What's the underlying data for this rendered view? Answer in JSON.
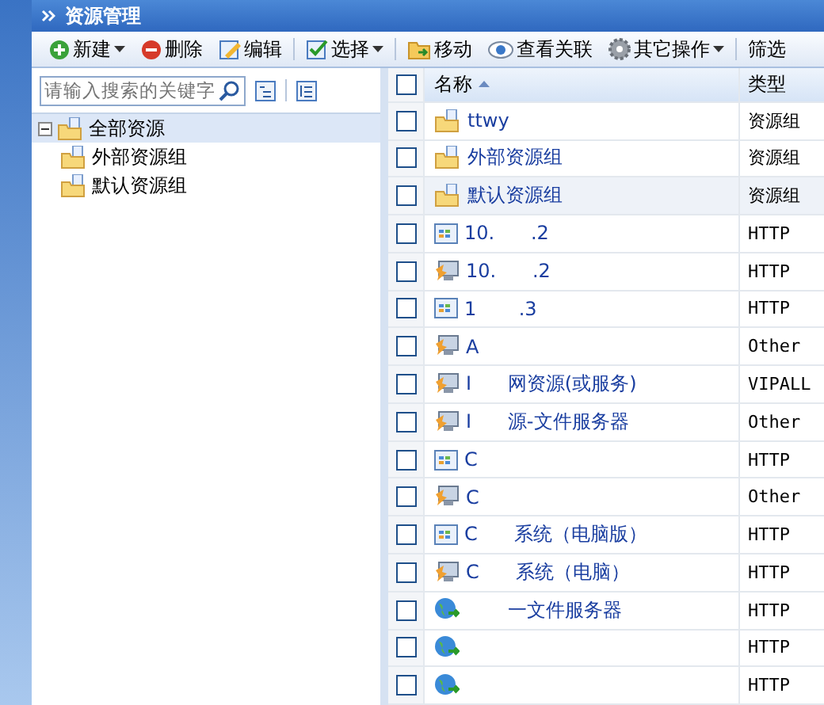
{
  "window": {
    "title": "资源管理"
  },
  "toolbar": [
    {
      "label": "新建",
      "kind": "add",
      "dropdown": true
    },
    {
      "label": "删除",
      "kind": "delete",
      "dropdown": false
    },
    {
      "label": "编辑",
      "kind": "edit",
      "dropdown": false
    },
    {
      "label": "选择",
      "kind": "check",
      "dropdown": true
    },
    {
      "label": "移动",
      "kind": "move",
      "dropdown": false
    },
    {
      "label": "查看关联",
      "kind": "eye",
      "dropdown": false
    },
    {
      "label": "其它操作",
      "kind": "gear",
      "dropdown": true
    },
    {
      "label": "筛选",
      "kind": "plain",
      "dropdown": false
    }
  ],
  "search": {
    "placeholder": "请输入搜索的关键字"
  },
  "tree": [
    {
      "label": "全部资源",
      "expanded": true,
      "selected": true,
      "children": [
        {
          "label": "外部资源组",
          "selected": false
        },
        {
          "label": "默认资源组",
          "selected": false
        }
      ]
    }
  ],
  "table": {
    "columns": [
      "名称",
      "类型"
    ],
    "all_checked": false,
    "rows": [
      {
        "kind": "folder",
        "name": "ttwy",
        "type": "资源组",
        "checked": false,
        "selected": false
      },
      {
        "kind": "folder",
        "name": "外部资源组",
        "type": "资源组",
        "checked": false,
        "selected": false
      },
      {
        "kind": "folder",
        "name": "默认资源组",
        "type": "资源组",
        "checked": false,
        "selected": true
      },
      {
        "kind": "app",
        "name": "10.      .2",
        "type": "HTTP",
        "checked": false,
        "selected": false
      },
      {
        "kind": "monitor",
        "name": "10.      .2",
        "type": "HTTP",
        "checked": false,
        "selected": false
      },
      {
        "kind": "app",
        "name": "1       .3",
        "type": "HTTP",
        "checked": false,
        "selected": false
      },
      {
        "kind": "monitor",
        "name": "A",
        "type": "Other",
        "checked": false,
        "selected": false
      },
      {
        "kind": "monitor",
        "name": "I      网资源(或服务)",
        "type": "VIPALL",
        "checked": false,
        "selected": false
      },
      {
        "kind": "monitor",
        "name": "I      源-文件服务器",
        "type": "Other",
        "checked": false,
        "selected": false
      },
      {
        "kind": "app",
        "name": "C",
        "type": "HTTP",
        "checked": false,
        "selected": false
      },
      {
        "kind": "monitor",
        "name": "C",
        "type": "Other",
        "checked": false,
        "selected": false
      },
      {
        "kind": "app",
        "name": "C      系统（电脑版）",
        "type": "HTTP",
        "checked": false,
        "selected": false
      },
      {
        "kind": "monitor",
        "name": "C      系统（电脑）",
        "type": "HTTP",
        "checked": false,
        "selected": false
      },
      {
        "kind": "globe",
        "name": "       一文件服务器",
        "type": "HTTP",
        "checked": false,
        "selected": false
      },
      {
        "kind": "globe",
        "name": "",
        "type": "HTTP",
        "checked": false,
        "selected": false
      },
      {
        "kind": "globe",
        "name": "",
        "type": "HTTP",
        "checked": false,
        "selected": false
      }
    ]
  }
}
